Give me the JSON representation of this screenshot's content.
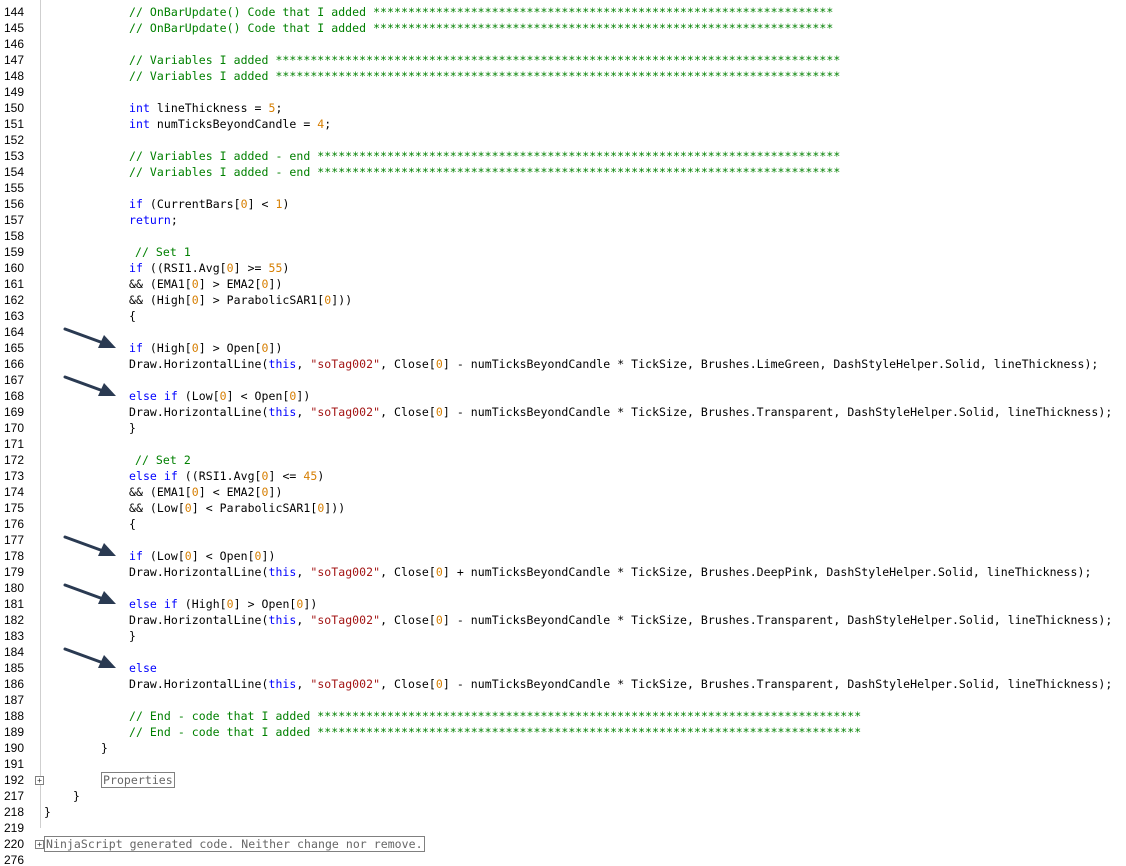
{
  "editor": {
    "lines": [
      {
        "n": "144",
        "parts": [
          {
            "t": "// OnBarUpdate() Code that I added ******************************************************************",
            "c": "cm"
          }
        ]
      },
      {
        "n": "145",
        "parts": [
          {
            "t": "// OnBarUpdate() Code that I added ******************************************************************",
            "c": "cm"
          }
        ]
      },
      {
        "n": "146",
        "parts": []
      },
      {
        "n": "147",
        "parts": [
          {
            "t": "// Variables I added *********************************************************************************",
            "c": "cm"
          }
        ]
      },
      {
        "n": "148",
        "parts": [
          {
            "t": "// Variables I added *********************************************************************************",
            "c": "cm"
          }
        ]
      },
      {
        "n": "149",
        "parts": []
      },
      {
        "n": "150",
        "parts": [
          {
            "t": "int",
            "c": "kw"
          },
          {
            "t": " lineThickness = "
          },
          {
            "t": "5",
            "c": "num"
          },
          {
            "t": ";"
          }
        ]
      },
      {
        "n": "151",
        "parts": [
          {
            "t": "int",
            "c": "kw"
          },
          {
            "t": " numTicksBeyondCandle = "
          },
          {
            "t": "4",
            "c": "num"
          },
          {
            "t": ";"
          }
        ]
      },
      {
        "n": "152",
        "parts": []
      },
      {
        "n": "153",
        "parts": [
          {
            "t": "// Variables I added - end ***************************************************************************",
            "c": "cm"
          }
        ]
      },
      {
        "n": "154",
        "parts": [
          {
            "t": "// Variables I added - end ***************************************************************************",
            "c": "cm"
          }
        ]
      },
      {
        "n": "155",
        "parts": []
      },
      {
        "n": "156",
        "parts": [
          {
            "t": "if",
            "c": "kw"
          },
          {
            "t": " (CurrentBars["
          },
          {
            "t": "0",
            "c": "num"
          },
          {
            "t": "] < "
          },
          {
            "t": "1",
            "c": "num"
          },
          {
            "t": ")"
          }
        ]
      },
      {
        "n": "157",
        "parts": [
          {
            "t": "return",
            "c": "kw"
          },
          {
            "t": ";"
          }
        ]
      },
      {
        "n": "158",
        "parts": []
      },
      {
        "n": "159",
        "indent": "i1",
        "parts": [
          {
            "t": "// Set 1",
            "c": "cm"
          }
        ]
      },
      {
        "n": "160",
        "parts": [
          {
            "t": "if",
            "c": "kw"
          },
          {
            "t": " ((RSI1.Avg["
          },
          {
            "t": "0",
            "c": "num"
          },
          {
            "t": "] >= "
          },
          {
            "t": "55",
            "c": "num"
          },
          {
            "t": ")"
          }
        ]
      },
      {
        "n": "161",
        "parts": [
          {
            "t": "&& (EMA1["
          },
          {
            "t": "0",
            "c": "num"
          },
          {
            "t": "] > EMA2["
          },
          {
            "t": "0",
            "c": "num"
          },
          {
            "t": "])"
          }
        ]
      },
      {
        "n": "162",
        "parts": [
          {
            "t": "&& (High["
          },
          {
            "t": "0",
            "c": "num"
          },
          {
            "t": "] > ParabolicSAR1["
          },
          {
            "t": "0",
            "c": "num"
          },
          {
            "t": "]))"
          }
        ]
      },
      {
        "n": "163",
        "parts": [
          {
            "t": "{"
          }
        ]
      },
      {
        "n": "164",
        "parts": []
      },
      {
        "n": "165",
        "parts": [
          {
            "t": "if",
            "c": "kw"
          },
          {
            "t": " (High["
          },
          {
            "t": "0",
            "c": "num"
          },
          {
            "t": "] > Open["
          },
          {
            "t": "0",
            "c": "num"
          },
          {
            "t": "])"
          }
        ]
      },
      {
        "n": "166",
        "parts": [
          {
            "t": "Draw.HorizontalLine("
          },
          {
            "t": "this",
            "c": "kw"
          },
          {
            "t": ", "
          },
          {
            "t": "\"soTag002\"",
            "c": "str"
          },
          {
            "t": ", Close["
          },
          {
            "t": "0",
            "c": "num"
          },
          {
            "t": "] - numTicksBeyondCandle * TickSize, Brushes.LimeGreen, DashStyleHelper.Solid, lineThickness);"
          }
        ]
      },
      {
        "n": "167",
        "parts": []
      },
      {
        "n": "168",
        "parts": [
          {
            "t": "else if",
            "c": "kw"
          },
          {
            "t": " (Low["
          },
          {
            "t": "0",
            "c": "num"
          },
          {
            "t": "] < Open["
          },
          {
            "t": "0",
            "c": "num"
          },
          {
            "t": "])"
          }
        ]
      },
      {
        "n": "169",
        "parts": [
          {
            "t": "Draw.HorizontalLine("
          },
          {
            "t": "this",
            "c": "kw"
          },
          {
            "t": ", "
          },
          {
            "t": "\"soTag002\"",
            "c": "str"
          },
          {
            "t": ", Close["
          },
          {
            "t": "0",
            "c": "num"
          },
          {
            "t": "] - numTicksBeyondCandle * TickSize, Brushes.Transparent, DashStyleHelper.Solid, lineThickness);"
          }
        ]
      },
      {
        "n": "170",
        "parts": [
          {
            "t": "}"
          }
        ]
      },
      {
        "n": "171",
        "parts": []
      },
      {
        "n": "172",
        "indent": "i1",
        "parts": [
          {
            "t": "// Set 2",
            "c": "cm"
          }
        ]
      },
      {
        "n": "173",
        "parts": [
          {
            "t": "else if",
            "c": "kw"
          },
          {
            "t": " ((RSI1.Avg["
          },
          {
            "t": "0",
            "c": "num"
          },
          {
            "t": "] <= "
          },
          {
            "t": "45",
            "c": "num"
          },
          {
            "t": ")"
          }
        ]
      },
      {
        "n": "174",
        "parts": [
          {
            "t": "&& (EMA1["
          },
          {
            "t": "0",
            "c": "num"
          },
          {
            "t": "] < EMA2["
          },
          {
            "t": "0",
            "c": "num"
          },
          {
            "t": "])"
          }
        ]
      },
      {
        "n": "175",
        "parts": [
          {
            "t": "&& (Low["
          },
          {
            "t": "0",
            "c": "num"
          },
          {
            "t": "] < ParabolicSAR1["
          },
          {
            "t": "0",
            "c": "num"
          },
          {
            "t": "]))"
          }
        ]
      },
      {
        "n": "176",
        "parts": [
          {
            "t": "{"
          }
        ]
      },
      {
        "n": "177",
        "parts": []
      },
      {
        "n": "178",
        "parts": [
          {
            "t": "if",
            "c": "kw"
          },
          {
            "t": " (Low["
          },
          {
            "t": "0",
            "c": "num"
          },
          {
            "t": "] < Open["
          },
          {
            "t": "0",
            "c": "num"
          },
          {
            "t": "])"
          }
        ]
      },
      {
        "n": "179",
        "parts": [
          {
            "t": "Draw.HorizontalLine("
          },
          {
            "t": "this",
            "c": "kw"
          },
          {
            "t": ", "
          },
          {
            "t": "\"soTag002\"",
            "c": "str"
          },
          {
            "t": ", Close["
          },
          {
            "t": "0",
            "c": "num"
          },
          {
            "t": "] + numTicksBeyondCandle * TickSize, Brushes.DeepPink, DashStyleHelper.Solid, lineThickness);"
          }
        ]
      },
      {
        "n": "180",
        "parts": []
      },
      {
        "n": "181",
        "parts": [
          {
            "t": "else if",
            "c": "kw"
          },
          {
            "t": " (High["
          },
          {
            "t": "0",
            "c": "num"
          },
          {
            "t": "] > Open["
          },
          {
            "t": "0",
            "c": "num"
          },
          {
            "t": "])"
          }
        ]
      },
      {
        "n": "182",
        "parts": [
          {
            "t": "Draw.HorizontalLine("
          },
          {
            "t": "this",
            "c": "kw"
          },
          {
            "t": ", "
          },
          {
            "t": "\"soTag002\"",
            "c": "str"
          },
          {
            "t": ", Close["
          },
          {
            "t": "0",
            "c": "num"
          },
          {
            "t": "] - numTicksBeyondCandle * TickSize, Brushes.Transparent, DashStyleHelper.Solid, lineThickness);"
          }
        ]
      },
      {
        "n": "183",
        "parts": [
          {
            "t": "}"
          }
        ]
      },
      {
        "n": "184",
        "parts": []
      },
      {
        "n": "185",
        "parts": [
          {
            "t": "else",
            "c": "kw"
          }
        ]
      },
      {
        "n": "186",
        "parts": [
          {
            "t": "Draw.HorizontalLine("
          },
          {
            "t": "this",
            "c": "kw"
          },
          {
            "t": ", "
          },
          {
            "t": "\"soTag002\"",
            "c": "str"
          },
          {
            "t": ", Close["
          },
          {
            "t": "0",
            "c": "num"
          },
          {
            "t": "] - numTicksBeyondCandle * TickSize, Brushes.Transparent, DashStyleHelper.Solid, lineThickness);"
          }
        ]
      },
      {
        "n": "187",
        "parts": []
      },
      {
        "n": "188",
        "parts": [
          {
            "t": "// End - code that I added ******************************************************************************",
            "c": "cm"
          }
        ]
      },
      {
        "n": "189",
        "parts": [
          {
            "t": "// End - code that I added ******************************************************************************",
            "c": "cm"
          }
        ]
      },
      {
        "n": "190",
        "indent": "i2",
        "parts": [
          {
            "t": "}"
          }
        ]
      },
      {
        "n": "191",
        "parts": []
      },
      {
        "n": "192",
        "indent": "i2",
        "fold": "+",
        "collapsed": "Properties",
        "parts": []
      },
      {
        "n": "217",
        "indent": "i3",
        "parts": [
          {
            "t": "}"
          }
        ]
      },
      {
        "n": "218",
        "indent": "i4",
        "parts": [
          {
            "t": "}"
          }
        ]
      },
      {
        "n": "219",
        "parts": []
      },
      {
        "n": "220",
        "indent": "i4",
        "fold": "+",
        "collapsed": "NinjaScript generated code. Neither change nor remove.",
        "parts": []
      },
      {
        "n": "276",
        "parts": []
      }
    ]
  },
  "colors": {
    "comment": "#008000",
    "keyword": "#0000ff",
    "number": "#d67e00",
    "string": "#a31515",
    "arrow": "#2a3a52"
  },
  "annotations": {
    "arrow_icon": "arrow-right-down-icon",
    "arrow_target_lines": [
      "165",
      "168",
      "178",
      "181",
      "185"
    ]
  }
}
